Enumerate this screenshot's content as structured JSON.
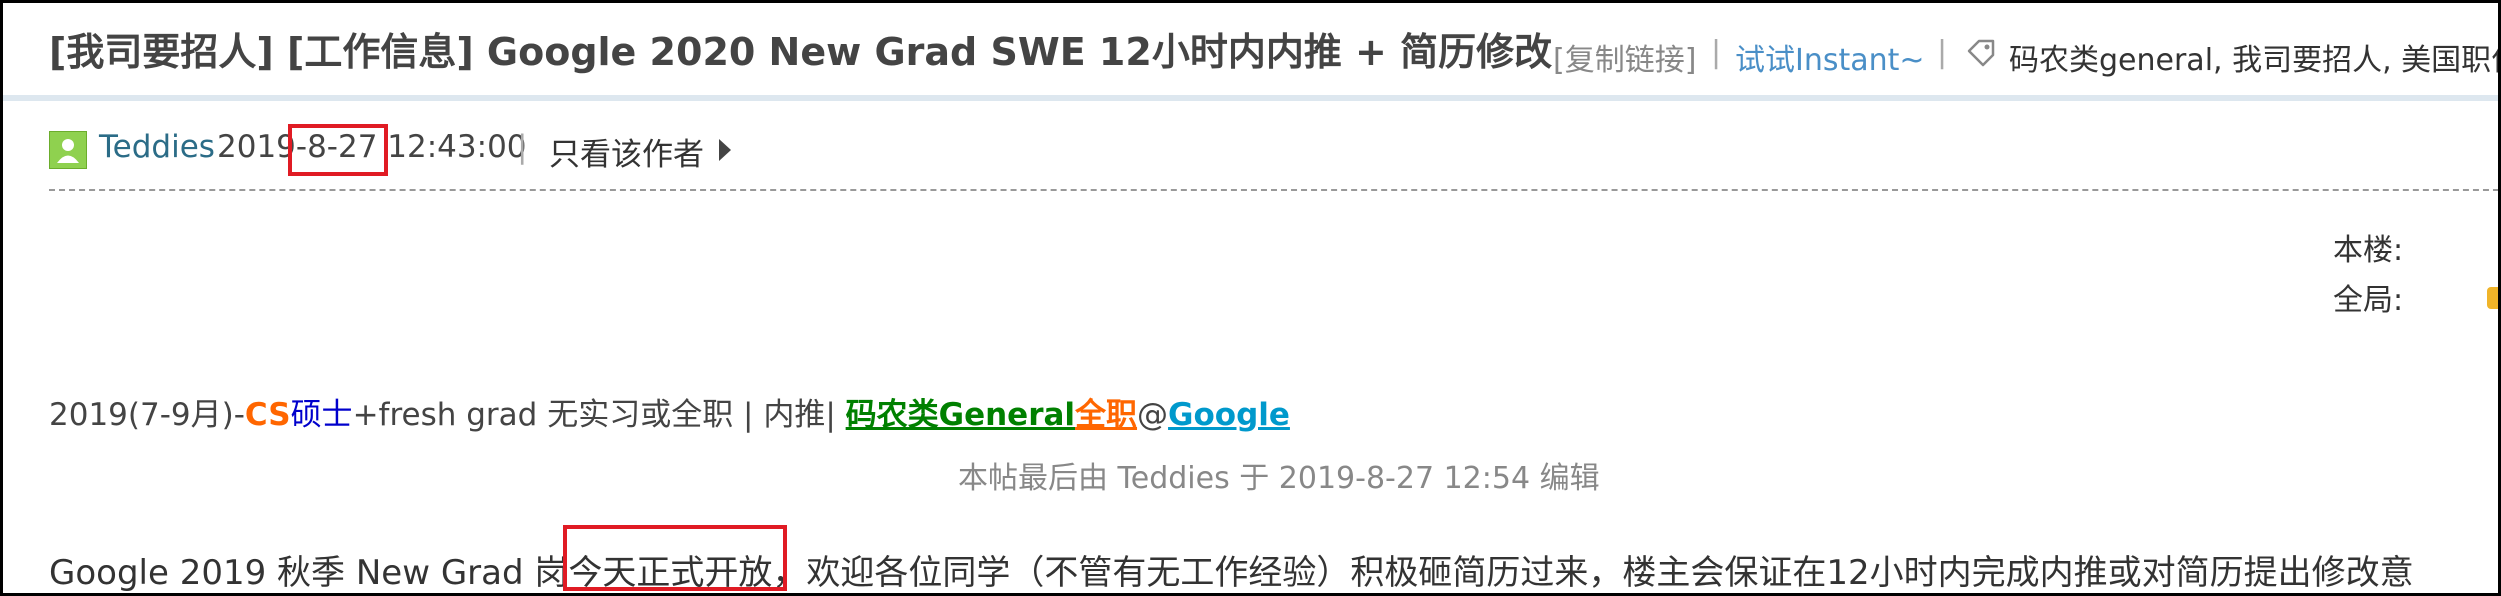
{
  "thread": {
    "title": "[我司要招人] [工作信息] Google 2020 New Grad SWE 12小时内内推 + 简历修改",
    "copy_link": "[复制链接]",
    "separator": "|",
    "instant_link": "试试Instant~",
    "tags": "码农类general, 我司要招人, 美国职位"
  },
  "post": {
    "author": "Teddies",
    "timestamp": "2019-8-27 12:43:00",
    "pipe": "|",
    "only_author": "只看该作者",
    "floor_label": "本楼:",
    "global_label": "全局:",
    "context": {
      "period": "2019(7-9月)-",
      "cs": "CS",
      "degree": "硕士",
      "rest": "+fresh grad 无实习或全职 | 内推| ",
      "category": "码农类General",
      "fulltime": "全职",
      "at": "@",
      "company": "Google"
    },
    "edit_note": "本帖最后由 Teddies 于 2019-8-27 12:54 编辑",
    "body_line": "Google 2019 秋季 New Grad 岗今天正式开放，欢迎各位同学（不管有无工作经验）积极砸简历过来，楼主会保证在12小时内完成内推或对简历提出修改意"
  },
  "colors": {
    "link": "#2b6c87",
    "highlight": "#e01b24",
    "orange": "#ff6600",
    "green": "#008000",
    "cyan": "#0099cc"
  }
}
